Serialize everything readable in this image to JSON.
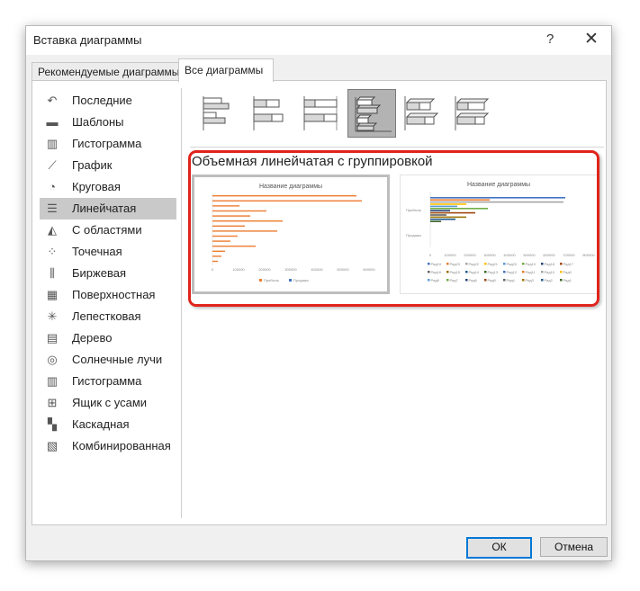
{
  "window": {
    "title": "Вставка диаграммы",
    "help": "?",
    "close": "✕"
  },
  "tabs": [
    {
      "label": "Рекомендуемые диаграммы"
    },
    {
      "label": "Все диаграммы"
    }
  ],
  "sidebar": {
    "items": [
      {
        "label": "Последние",
        "icon": "undo-arrow-icon"
      },
      {
        "label": "Шаблоны",
        "icon": "folder-icon"
      },
      {
        "label": "Гистограмма",
        "icon": "column-chart-icon"
      },
      {
        "label": "График",
        "icon": "line-chart-icon"
      },
      {
        "label": "Круговая",
        "icon": "pie-chart-icon"
      },
      {
        "label": "Линейчатая",
        "icon": "bar-chart-icon"
      },
      {
        "label": "С областями",
        "icon": "area-chart-icon"
      },
      {
        "label": "Точечная",
        "icon": "scatter-chart-icon"
      },
      {
        "label": "Биржевая",
        "icon": "stock-chart-icon"
      },
      {
        "label": "Поверхностная",
        "icon": "surface-chart-icon"
      },
      {
        "label": "Лепестковая",
        "icon": "radar-chart-icon"
      },
      {
        "label": "Дерево",
        "icon": "treemap-icon"
      },
      {
        "label": "Солнечные лучи",
        "icon": "sunburst-icon"
      },
      {
        "label": "Гистограмма",
        "icon": "histogram-icon"
      },
      {
        "label": "Ящик с усами",
        "icon": "box-whisker-icon"
      },
      {
        "label": "Каскадная",
        "icon": "waterfall-icon"
      },
      {
        "label": "Комбинированная",
        "icon": "combo-chart-icon"
      }
    ],
    "selected_index": 5
  },
  "chart_subtypes": {
    "selected_index": 3,
    "items": [
      "clustered-bar-icon",
      "stacked-bar-icon",
      "stacked-100-bar-icon",
      "3d-clustered-bar-icon",
      "3d-stacked-bar-icon",
      "3d-stacked-100-bar-icon"
    ]
  },
  "subtype_title": "Объемная линейчатая с группировкой",
  "previews": [
    {
      "title": "Название диаграммы",
      "x_ticks": [
        "0",
        "100000",
        "200000",
        "300000",
        "400000",
        "500000",
        "600000"
      ],
      "legend": [
        "Прибыль",
        "Продажи"
      ],
      "colors": {
        "series1": "#ed7d31",
        "series2": "#4472c4"
      }
    },
    {
      "title": "Название диаграммы",
      "y_labels": [
        "Прибыль",
        "Продажи"
      ],
      "x_ticks": [
        "0",
        "100000",
        "200000",
        "300000",
        "400000",
        "500000",
        "600000",
        "700000",
        "800000"
      ],
      "legend_rows": [
        [
          "Ряд24",
          "Ряд23",
          "Ряд22",
          "Ряд21",
          "Ряд20",
          "Ряд19",
          "Ряд18",
          "Ряд17"
        ],
        [
          "Ряд16",
          "Ряд15",
          "Ряд14",
          "Ряд13",
          "Ряд12",
          "Ряд11",
          "Ряд10",
          "Ряд9"
        ],
        [
          "Ряд8",
          "Ряд7",
          "Ряд6",
          "Ряд5",
          "Ряд4",
          "Ряд3",
          "Ряд2",
          "Ряд1"
        ]
      ]
    }
  ],
  "buttons": {
    "ok": "ОК",
    "cancel": "Отмена"
  },
  "colors": {
    "highlight": "#e0241c",
    "selected_tab": "#ffffff",
    "ok_border": "#0078d7"
  }
}
